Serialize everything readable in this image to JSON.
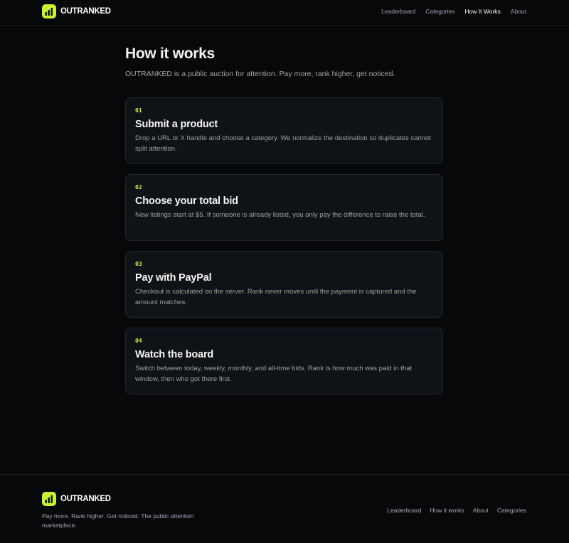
{
  "brand": {
    "name": "OUTRANKED",
    "icon": "bar-chart-icon",
    "accent": "#c6f432"
  },
  "nav": {
    "items": [
      {
        "label": "Leaderboard",
        "active": false
      },
      {
        "label": "Categories",
        "active": false
      },
      {
        "label": "How It Works",
        "active": true
      },
      {
        "label": "About",
        "active": false
      }
    ]
  },
  "page": {
    "title": "How it works",
    "subtitle": "OUTRANKED is a public auction for attention. Pay more, rank higher, get noticed."
  },
  "steps": [
    {
      "num": "01",
      "title": "Submit a product",
      "desc": "Drop a URL or X handle and choose a category. We normalize the destination so duplicates cannot split attention."
    },
    {
      "num": "02",
      "title": "Choose your total bid",
      "desc": "New listings start at $5. If someone is already listed, you only pay the difference to raise the total."
    },
    {
      "num": "03",
      "title": "Pay with PayPal",
      "desc": "Checkout is calculated on the server. Rank never moves until the payment is captured and the amount matches."
    },
    {
      "num": "04",
      "title": "Watch the board",
      "desc": "Switch between today, weekly, monthly, and all-time bids. Rank is how much was paid in that window, then who got there first."
    }
  ],
  "footer": {
    "tagline": "Pay more. Rank higher. Get noticed. The public attention marketplace.",
    "links": [
      {
        "label": "Leaderboard"
      },
      {
        "label": "How it works"
      },
      {
        "label": "About"
      },
      {
        "label": "Categories"
      }
    ]
  }
}
